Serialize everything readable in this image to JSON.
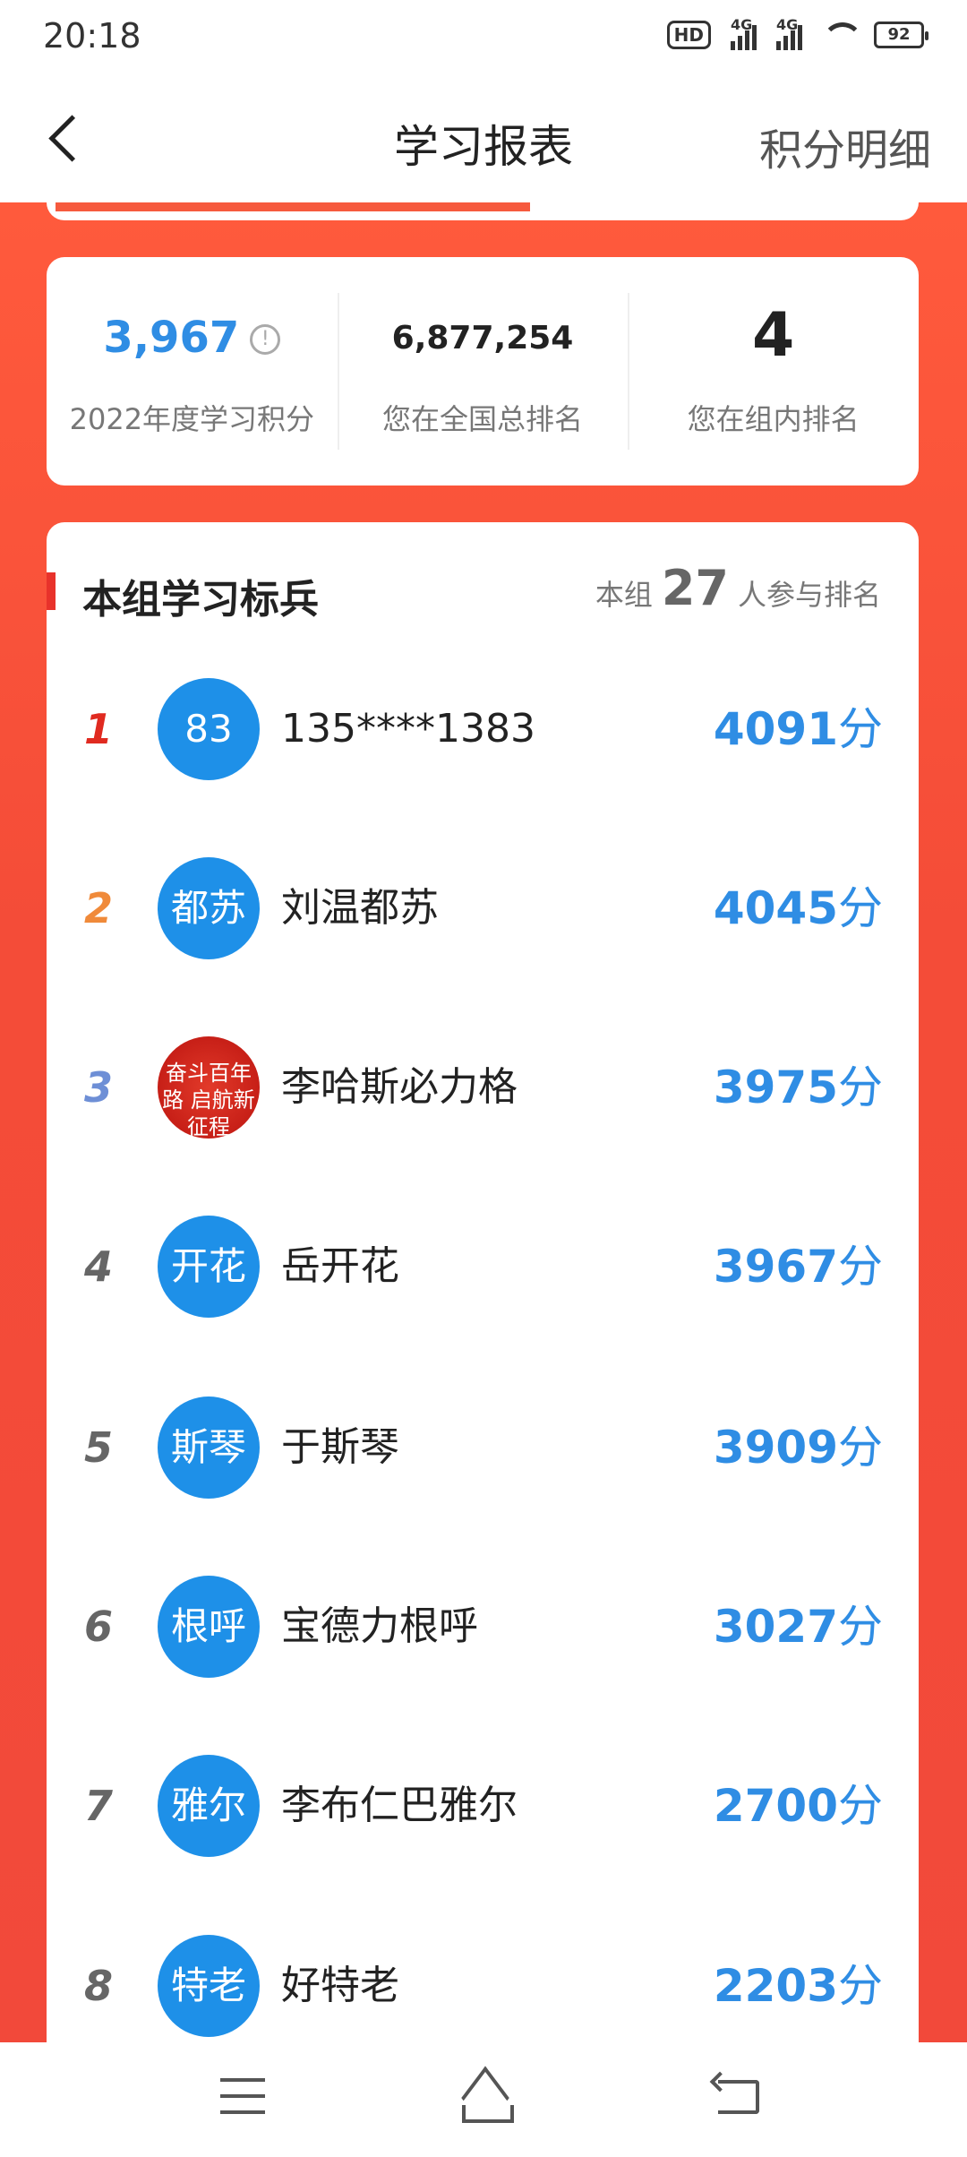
{
  "status_bar": {
    "time": "20:18",
    "hd_label": "HD",
    "network_1": "4G",
    "network_2": "4G",
    "battery": "92"
  },
  "nav": {
    "title": "学习报表",
    "right_action": "积分明细"
  },
  "stats": [
    {
      "value": "3,967",
      "label": "2022年度学习积分",
      "info_icon": "!"
    },
    {
      "value": "6,877,254",
      "label": "您在全国总排名"
    },
    {
      "value": "4",
      "label": "您在组内排名"
    }
  ],
  "ranking": {
    "title": "本组学习标兵",
    "meta_prefix": "本组",
    "participant_count": "27",
    "meta_suffix": "人参与排名",
    "score_unit": "分",
    "members": [
      {
        "rank": "1",
        "avatar_text": "83",
        "name": "135****1383",
        "score": "4091"
      },
      {
        "rank": "2",
        "avatar_text": "都苏",
        "name": "刘温都苏",
        "score": "4045"
      },
      {
        "rank": "3",
        "avatar_text": "奋斗百年路 启航新征程",
        "name": "李哈斯必力格",
        "score": "3975"
      },
      {
        "rank": "4",
        "avatar_text": "开花",
        "name": "岳开花",
        "score": "3967"
      },
      {
        "rank": "5",
        "avatar_text": "斯琴",
        "name": "于斯琴",
        "score": "3909"
      },
      {
        "rank": "6",
        "avatar_text": "根呼",
        "name": "宝德力根呼",
        "score": "3027"
      },
      {
        "rank": "7",
        "avatar_text": "雅尔",
        "name": "李布仁巴雅尔",
        "score": "2700"
      },
      {
        "rank": "8",
        "avatar_text": "特老",
        "name": "好特老",
        "score": "2203"
      }
    ]
  },
  "colors": {
    "accent_red": "#f44c38",
    "score_blue": "#2f8de4",
    "avatar_blue": "#1e90e8"
  }
}
